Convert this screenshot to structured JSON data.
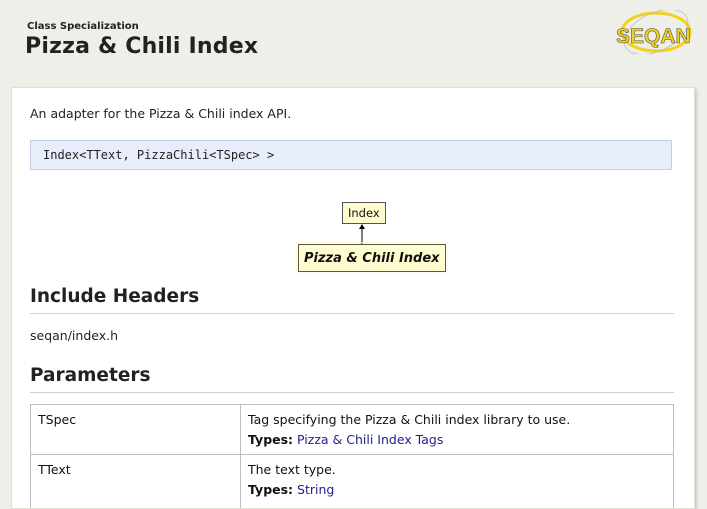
{
  "header": {
    "kind": "Class Specialization",
    "title": "Pizza & Chili Index",
    "logo_text": "SEQAN"
  },
  "colors": {
    "page_bg": "#efefe9",
    "signature_bg": "#e7edfa",
    "node_bg": "#fffcd0",
    "link": "#22228e",
    "logo_yellow": "#f2d21b"
  },
  "main": {
    "description": "An adapter for the Pizza & Chili index API.",
    "signature": "Index<TText, PizzaChili<TSpec> >",
    "diagram": {
      "base": "Index",
      "self": "Pizza & Chili Index"
    },
    "include_heading": "Include Headers",
    "include_file": "seqan/index.h",
    "params_heading": "Parameters",
    "params": [
      {
        "name": "TSpec",
        "desc": "Tag specifying the Pizza & Chili index library to use.",
        "types_label": "Types:",
        "types_link": "Pizza & Chili Index Tags"
      },
      {
        "name": "TText",
        "desc": "The text type.",
        "types_label": "Types:",
        "types_link": "String"
      }
    ]
  }
}
